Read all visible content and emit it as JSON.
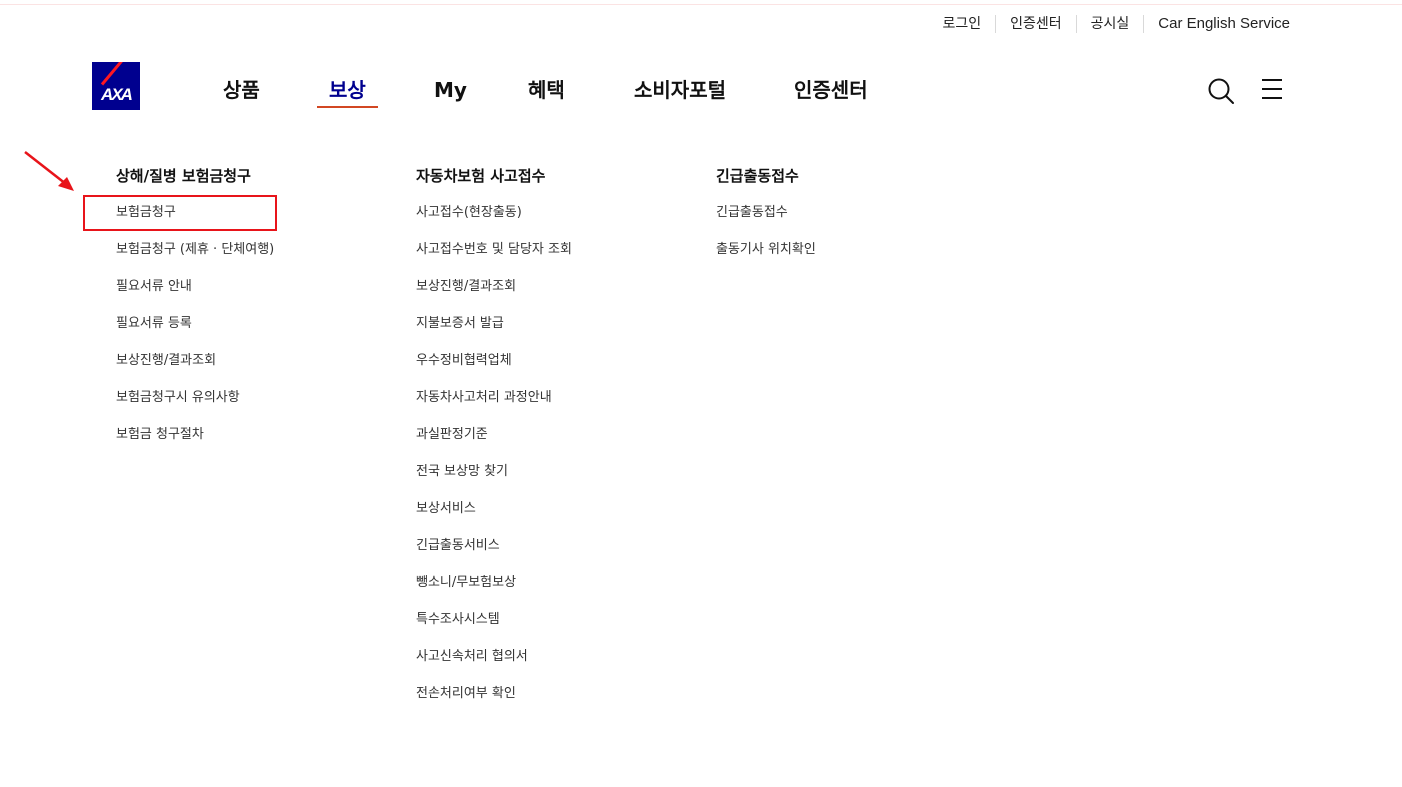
{
  "utility_nav": [
    "로그인",
    "인증센터",
    "공시실",
    "Car English Service"
  ],
  "logo_text": "AXA",
  "main_nav": [
    {
      "label": "상품",
      "active": false
    },
    {
      "label": "보상",
      "active": true
    },
    {
      "label": "My",
      "active": false
    },
    {
      "label": "혜택",
      "active": false
    },
    {
      "label": "소비자포털",
      "active": false
    },
    {
      "label": "인증센터",
      "active": false
    }
  ],
  "icons": {
    "search": "search-icon",
    "menu": "hamburger-menu-icon",
    "annotation": "red-arrow-icon"
  },
  "colors": {
    "brand": "#00008f",
    "accent": "#ff1721",
    "active_underline": "#d24723",
    "highlight_box": "#e8141a"
  },
  "mega_menu": [
    {
      "title": "상해/질병 보험금청구",
      "items": [
        "보험금청구",
        "보험금청구 (제휴 · 단체여행)",
        "필요서류 안내",
        "필요서류 등록",
        "보상진행/결과조회",
        "보험금청구시 유의사항",
        "보험금 청구절차"
      ]
    },
    {
      "title": "자동차보험 사고접수",
      "items": [
        "사고접수(현장출동)",
        "사고접수번호 및 담당자 조회",
        "보상진행/결과조회",
        "지불보증서 발급",
        "우수정비협력업체",
        "자동차사고처리 과정안내",
        "과실판정기준",
        "전국 보상망 찾기",
        "보상서비스",
        "긴급출동서비스",
        "뺑소니/무보험보상",
        "특수조사시스템",
        "사고신속처리 협의서",
        "전손처리여부 확인"
      ]
    },
    {
      "title": "긴급출동접수",
      "items": [
        "긴급출동접수",
        "출동기사 위치확인"
      ]
    }
  ]
}
